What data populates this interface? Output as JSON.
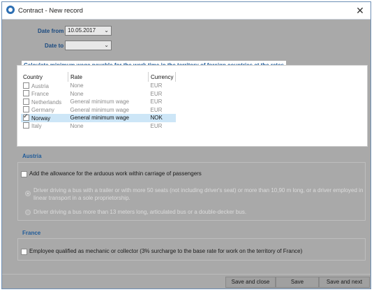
{
  "window": {
    "title": "Contract - New record"
  },
  "form": {
    "date_from_label": "Date from",
    "date_from_value": "10.05.2017",
    "date_to_label": "Date to",
    "date_to_value": ""
  },
  "rates_panel": {
    "caption": "Calculate minimum wage payable for the work time in the territory of foreign countries at the rates",
    "columns": [
      "Country",
      "Rate",
      "Currency"
    ],
    "rows": [
      {
        "country": "Austria",
        "rate": "None",
        "currency": "EUR",
        "checked": false,
        "selected": false
      },
      {
        "country": "France",
        "rate": "None",
        "currency": "EUR",
        "checked": false,
        "selected": false
      },
      {
        "country": "Netherlands",
        "rate": "General minimum wage",
        "currency": "EUR",
        "checked": false,
        "selected": false
      },
      {
        "country": "Germany",
        "rate": "General minimum wage",
        "currency": "EUR",
        "checked": false,
        "selected": false
      },
      {
        "country": "Norway",
        "rate": "General minimum wage",
        "currency": "NOK",
        "checked": true,
        "selected": true
      },
      {
        "country": "Italy",
        "rate": "None",
        "currency": "EUR",
        "checked": false,
        "selected": false
      }
    ]
  },
  "austria": {
    "title": "Austria",
    "allowance_label": "Add the allowance for the arduous work within carriage of passengers",
    "option1_line1": "Driver driving a bus with a trailer or with more 50 seats (not including driver's seat) or more than 10,90 m long, or a driver employed in",
    "option1_line2": "linear transport in a sole proprietorship.",
    "option2": "Driver driving a bus more than 13 meters long, articulated bus or a double-decker bus."
  },
  "france": {
    "title": "France",
    "mechanic_label": "Employee qualified as mechanic or collector (3% surcharge to the base rate for work on the territory of France)"
  },
  "buttons": {
    "save_close": "Save and close",
    "save": "Save",
    "save_next": "Save and next"
  }
}
